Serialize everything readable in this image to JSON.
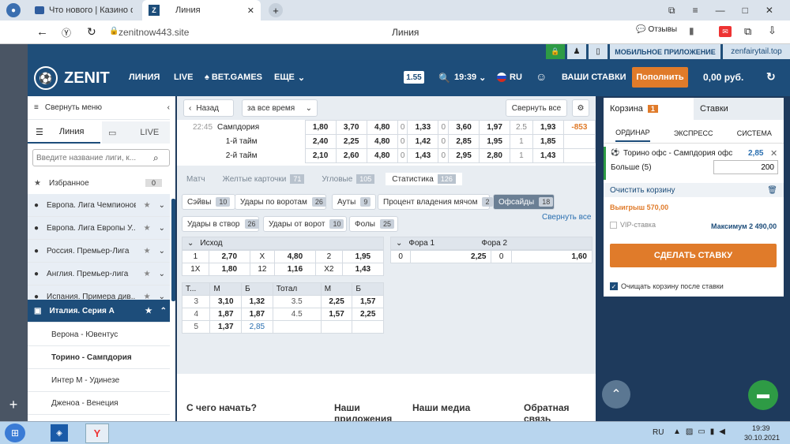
{
  "browser": {
    "tabs": [
      {
        "label": "Что нового | Казино фор"
      },
      {
        "label": "Линия"
      }
    ],
    "url": "zenitnow443.site",
    "page_title": "Линия",
    "reviews_label": "Отзывы"
  },
  "promo": {
    "mobile_app": "МОБИЛЬНОЕ ПРИЛОЖЕНИЕ",
    "mirror": "zenfairytail.top"
  },
  "nav": {
    "logo": "ZENIT",
    "items": [
      "ЛИНИЯ",
      "LIVE",
      "BET.GAMES",
      "ЕЩЕ"
    ],
    "odds_format": "1.55",
    "time": "19:39",
    "lang": "RU",
    "my_bets": "ВАШИ СТАВКИ",
    "deposit": "Пополнить",
    "balance": "0,00 руб."
  },
  "sidebar": {
    "collapse": "Свернуть меню",
    "tab_line": "Линия",
    "tab_live": "LIVE",
    "search_placeholder": "Введите название лиги, к...",
    "favorites": "Избранное",
    "favorites_count": "0",
    "leagues": [
      "Европа. Лига Чемпионов",
      "Европа. Лига Европы У...",
      "Россия. Премьер-Лига",
      "Англия. Премьер-лига",
      "Испания. Примера див..."
    ],
    "active_league": "Италия. Серия А",
    "matches": [
      "Верона - Ювентус",
      "Торино - Сампдория",
      "Интер М - Удинезе",
      "Дженоа - Венеция"
    ]
  },
  "main": {
    "back": "Назад",
    "period": "за все время",
    "collapse_all": "Свернуть все",
    "match_time": "22:45",
    "match_name": "Сампдория",
    "rows": [
      {
        "label": "",
        "c": [
          "1,80",
          "3,70",
          "4,80",
          "0",
          "1,33",
          "0",
          "3,60",
          "1,97",
          "2.5",
          "1,93",
          "-853"
        ]
      },
      {
        "label": "1-й тайм",
        "c": [
          "2,40",
          "2,25",
          "4,80",
          "0",
          "1,42",
          "0",
          "2,85",
          "1,95",
          "1",
          "1,85",
          ""
        ]
      },
      {
        "label": "2-й тайм",
        "c": [
          "2,10",
          "2,60",
          "4,80",
          "0",
          "1,43",
          "0",
          "2,95",
          "2,80",
          "1",
          "1,43",
          ""
        ]
      }
    ],
    "stat_tabs": [
      {
        "label": "Матч",
        "count": ""
      },
      {
        "label": "Желтые карточки",
        "count": "71"
      },
      {
        "label": "Угловые",
        "count": "105"
      },
      {
        "label": "Статистика",
        "count": "126"
      }
    ],
    "filters": [
      {
        "label": "Сэйвы",
        "count": "10"
      },
      {
        "label": "Удары по воротам",
        "count": "26"
      },
      {
        "label": "Ауты",
        "count": "9"
      },
      {
        "label": "Процент владения мячом",
        "count": "2"
      },
      {
        "label": "Офсайды",
        "count": "18"
      },
      {
        "label": "Удары в створ",
        "count": "26"
      },
      {
        "label": "Удары от ворот",
        "count": "10"
      },
      {
        "label": "Фолы",
        "count": "25"
      }
    ],
    "collapse_all2": "Свернуть все",
    "outcome": {
      "title": "Исход",
      "rows": [
        [
          "1",
          "2,70",
          "X",
          "4,80",
          "2",
          "1,95"
        ],
        [
          "1X",
          "1,80",
          "12",
          "1,16",
          "X2",
          "1,43"
        ]
      ]
    },
    "handicap": {
      "title1": "Фора 1",
      "title2": "Фора 2",
      "row": [
        "0",
        "2,25",
        "0",
        "1,60"
      ]
    },
    "totals": {
      "headers": [
        "Т...",
        "М",
        "Б",
        "Тотал",
        "М",
        "Б"
      ],
      "rows": [
        [
          "3",
          "3,10",
          "1,32",
          "3.5",
          "2,25",
          "1,57"
        ],
        [
          "4",
          "1,87",
          "1,87",
          "4.5",
          "1,57",
          "2,25"
        ],
        [
          "5",
          "1,37",
          "2,85",
          "",
          "",
          ""
        ]
      ]
    },
    "footer": [
      "С чего начать?",
      "Наши приложения",
      "Наши медиа",
      "Обратная связь"
    ]
  },
  "betslip": {
    "tab_cart": "Корзина",
    "cart_count": "1",
    "tab_bets": "Ставки",
    "types": [
      "ОРДИНАР",
      "ЭКСПРЕСС",
      "СИСТЕМА"
    ],
    "event": "Торино офс - Сампдория офс",
    "odds": "2,85",
    "selection": "Больше (5)",
    "stake": "200",
    "clear": "Очистить корзину",
    "win": "Выигрыш 570,00",
    "vip": "VIP-ставка",
    "max": "Максимум 2 490,00",
    "place": "СДЕЛАТЬ СТАВКУ",
    "clear_after": "Очищать корзину после ставки"
  },
  "taskbar": {
    "lang": "RU",
    "time": "19:39",
    "date": "30.10.2021"
  },
  "colors": {
    "brand": "#1d4d7a",
    "accent": "#e07b2a",
    "green": "#2e9b45"
  }
}
